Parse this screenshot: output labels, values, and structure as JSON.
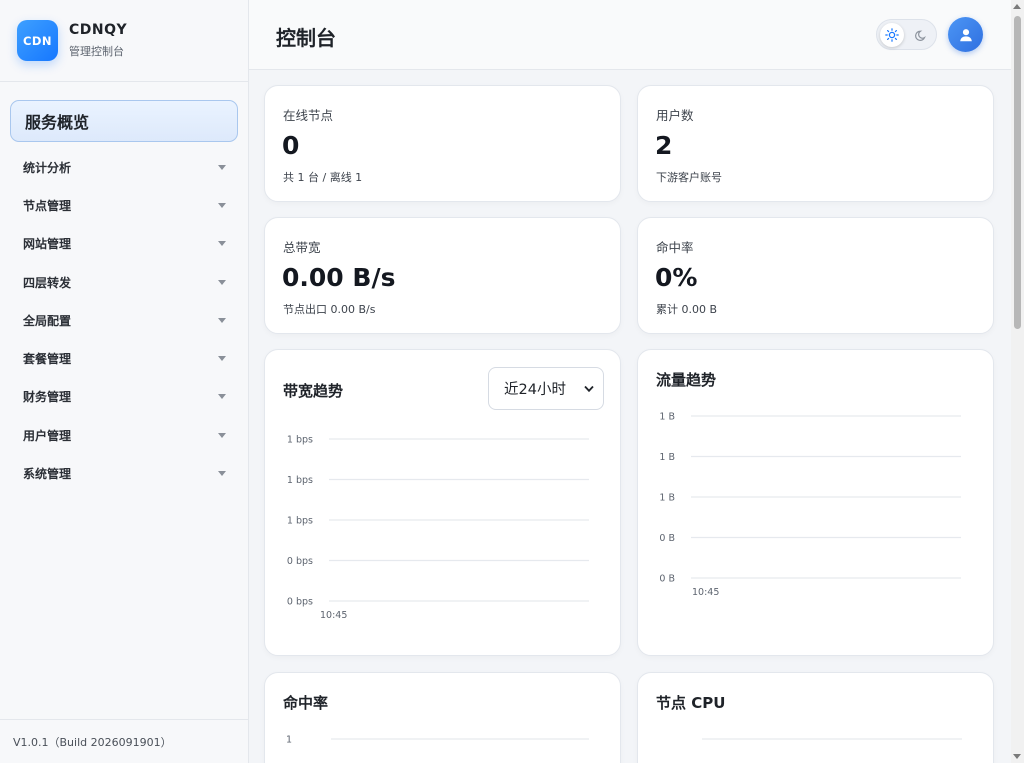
{
  "brand": {
    "logo": "CDN",
    "name": "CDNQY",
    "subtitle": "管理控制台"
  },
  "sidebar": {
    "active": "服务概览",
    "items": [
      {
        "label": "统计分析"
      },
      {
        "label": "节点管理"
      },
      {
        "label": "网站管理"
      },
      {
        "label": "四层转发"
      },
      {
        "label": "全局配置"
      },
      {
        "label": "套餐管理"
      },
      {
        "label": "财务管理"
      },
      {
        "label": "用户管理"
      },
      {
        "label": "系统管理"
      }
    ],
    "version": "V1.0.1（Build 2026091901）"
  },
  "header": {
    "title": "控制台",
    "theme_icons": [
      "sun-icon",
      "moon-icon"
    ],
    "avatar_icon": "user-icon"
  },
  "stats": [
    {
      "label": "在线节点",
      "value": "0",
      "sub": "共 1 台 / 离线 1"
    },
    {
      "label": "用户数",
      "value": "2",
      "sub": "下游客户账号"
    },
    {
      "label": "总带宽",
      "value": "0.00 B/s",
      "sub": "节点出口 0.00 B/s"
    },
    {
      "label": "命中率",
      "value": "0%",
      "sub": "累计 0.00 B"
    }
  ],
  "charts": {
    "bandwidth": {
      "title": "带宽趋势",
      "range": "近24小时"
    },
    "traffic": {
      "title": "流量趋势"
    },
    "hit": {
      "title": "命中率"
    },
    "cpu": {
      "title": "节点 CPU"
    }
  },
  "colors": {
    "accent": "#1677ff",
    "avatar": "#3a7de8",
    "grid": "#e6e9ee"
  },
  "chart_data": [
    {
      "type": "line",
      "title": "带宽趋势",
      "x": [
        "10:45"
      ],
      "y_ticks": [
        "1 bps",
        "1 bps",
        "1 bps",
        "0 bps",
        "0 bps"
      ],
      "series": [],
      "grid": true
    },
    {
      "type": "line",
      "title": "流量趋势",
      "x": [
        "10:45"
      ],
      "y_ticks": [
        "1 B",
        "1 B",
        "1 B",
        "0 B",
        "0 B"
      ],
      "series": [],
      "grid": true
    },
    {
      "type": "line",
      "title": "命中率",
      "x": [],
      "y_ticks": [
        "1"
      ],
      "series": [],
      "grid": true
    },
    {
      "type": "line",
      "title": "节点 CPU",
      "x": [],
      "y_ticks": [],
      "series": [],
      "grid": true
    }
  ]
}
